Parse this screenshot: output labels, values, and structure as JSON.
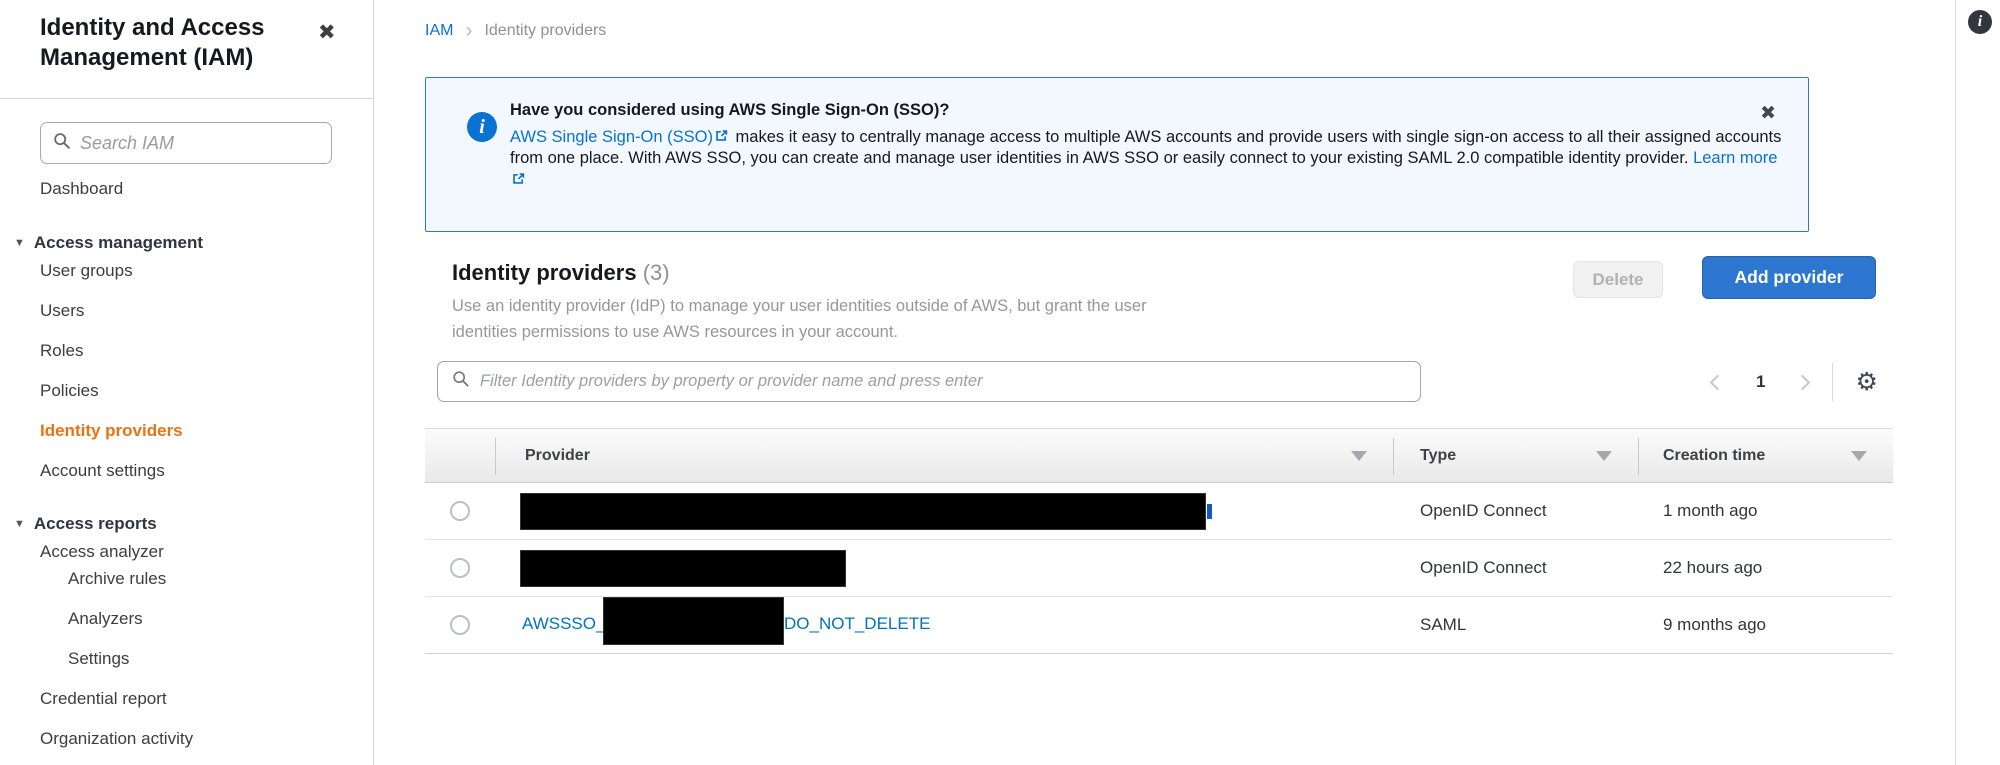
{
  "colors": {
    "accent_orange": "#ec7211",
    "link_blue": "#0972d3",
    "table_link_blue": "#0073bb",
    "banner_border": "#3077cf",
    "banner_bg": "#f2f8fd",
    "primary_button_bg": "#2e77d0",
    "redaction": "#000000"
  },
  "icons": {
    "close": "✖",
    "gear": "⚙",
    "section_caret": "▼",
    "breadcrumb_chevron": "›",
    "info": "i"
  },
  "sidebar": {
    "title": "Identity and Access Management (IAM)",
    "search_placeholder": "Search IAM",
    "items": [
      {
        "label": "Dashboard"
      },
      {
        "label": "Access management"
      },
      {
        "label": "User groups"
      },
      {
        "label": "Users"
      },
      {
        "label": "Roles"
      },
      {
        "label": "Policies"
      },
      {
        "label": "Identity providers",
        "selected": true
      },
      {
        "label": "Account settings"
      },
      {
        "label": "Access reports"
      },
      {
        "label": "Access analyzer"
      },
      {
        "label": "Archive rules"
      },
      {
        "label": "Analyzers"
      },
      {
        "label": "Settings"
      },
      {
        "label": "Credential report"
      },
      {
        "label": "Organization activity"
      }
    ]
  },
  "breadcrumb": {
    "root": "IAM",
    "current": "Identity providers"
  },
  "banner": {
    "title": "Have you considered using AWS Single Sign-On (SSO)?",
    "link_sso": "AWS Single Sign-On (SSO)",
    "body": " makes it easy to centrally manage access to multiple AWS accounts and provide users with single sign-on access to all their assigned accounts from one place. With AWS SSO, you can create and manage user identities in AWS SSO or easily connect to your existing SAML 2.0 compatible identity provider. ",
    "link_learn_more": "Learn more"
  },
  "section": {
    "title": "Identity providers",
    "count": "(3)",
    "description": "Use an identity provider (IdP) to manage your user identities outside of AWS, but grant the user identities permissions to use AWS resources in your account.",
    "delete_button": "Delete",
    "add_button": "Add provider"
  },
  "filter": {
    "placeholder": "Filter Identity providers by property or provider name and press enter"
  },
  "pagination": {
    "current_page": "1"
  },
  "table": {
    "columns": [
      {
        "label": "Provider"
      },
      {
        "label": "Type"
      },
      {
        "label": "Creation time"
      }
    ],
    "rows": [
      {
        "provider": "[redacted]",
        "type": "OpenID Connect",
        "creation_time": "1 month ago"
      },
      {
        "provider": "[redacted]",
        "type": "OpenID Connect",
        "creation_time": "22 hours ago"
      },
      {
        "provider_prefix": "AWSSSO_",
        "provider_middle": "[redacted]",
        "provider_suffix": "DO_NOT_DELETE",
        "type": "SAML",
        "creation_time": "9 months ago"
      }
    ]
  }
}
